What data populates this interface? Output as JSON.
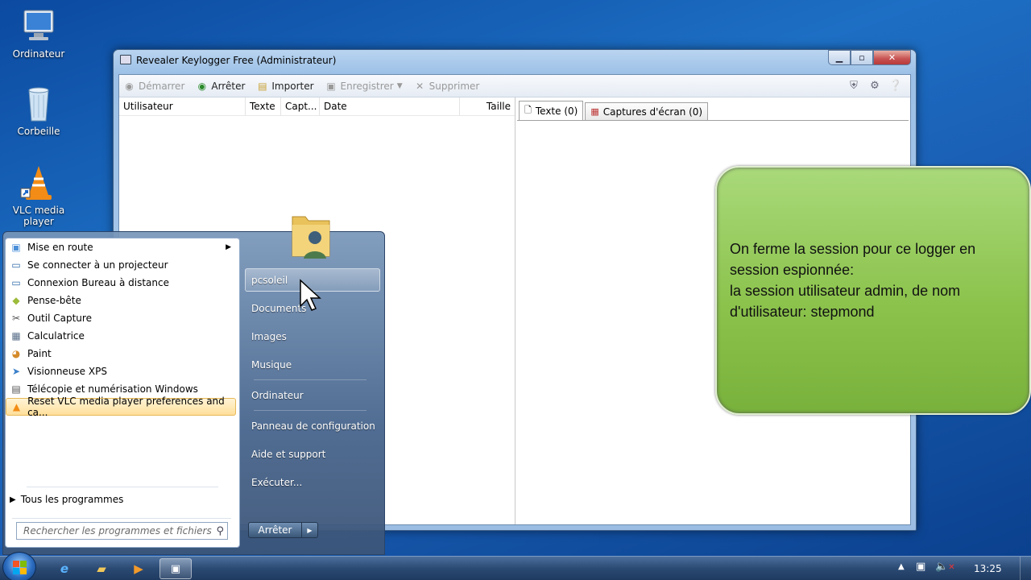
{
  "desktop": {
    "icons": [
      {
        "label": "Ordinateur",
        "icon": "computer-icon"
      },
      {
        "label": "Corbeille",
        "icon": "recycle-bin-icon"
      },
      {
        "label": "VLC media player",
        "icon": "vlc-icon"
      }
    ]
  },
  "window": {
    "title": "Revealer Keylogger Free (Administrateur)",
    "toolbar": {
      "start": "Démarrer",
      "stop": "Arrêter",
      "import": "Importer",
      "save": "Enregistrer",
      "delete": "Supprimer"
    },
    "columns": [
      "Utilisateur",
      "Texte",
      "Capt...",
      "Date",
      "Taille"
    ],
    "tabs": [
      "Texte (0)",
      "Captures d'écran (0)"
    ]
  },
  "start_menu": {
    "programs": [
      "Mise en route",
      "Se connecter à un projecteur",
      "Connexion Bureau à distance",
      "Pense-bête",
      "Outil Capture",
      "Calculatrice",
      "Paint",
      "Visionneuse XPS",
      "Télécopie et numérisation Windows",
      "Reset VLC media player preferences and ca..."
    ],
    "all_programs": "Tous les programmes",
    "search_placeholder": "Rechercher les programmes et fichiers",
    "right_items": [
      "pcsoleil",
      "Documents",
      "Images",
      "Musique",
      "Ordinateur",
      "Panneau de configuration",
      "Aide et support",
      "Exécuter..."
    ],
    "shutdown": "Arrêter"
  },
  "callout": {
    "text": "On ferme la session pour ce logger en session espionnée:\nla session utilisateur admin, de nom d'utilisateur: stepmond"
  },
  "taskbar": {
    "clock": "13:25"
  }
}
